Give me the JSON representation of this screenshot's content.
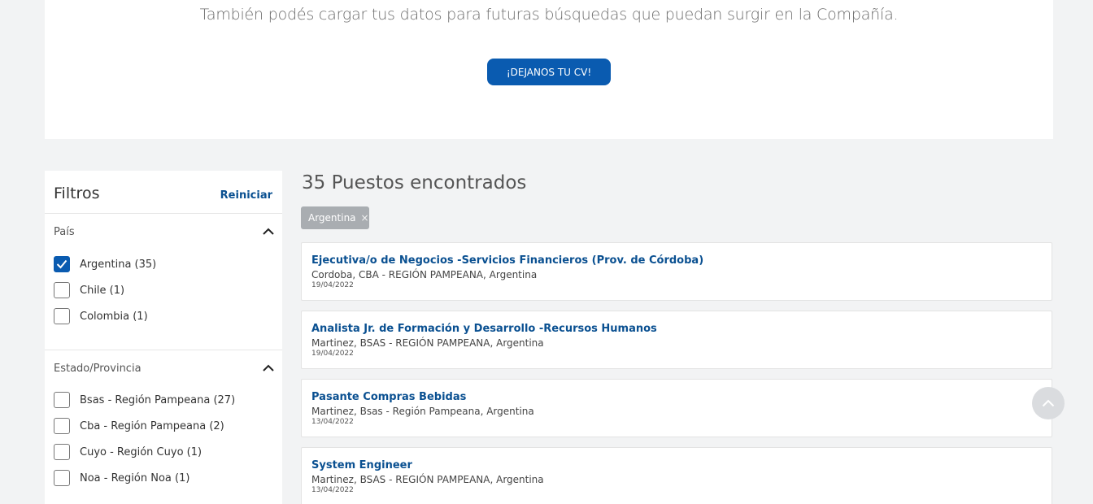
{
  "top": {
    "message": "También podés cargar tus datos para futuras búsquedas que puedan surgir en la Compañía.",
    "cv_button": "¡DEJANOS TU CV!"
  },
  "filters": {
    "title": "Filtros",
    "reset": "Reiniciar",
    "country": {
      "title": "País",
      "options": [
        {
          "label": "Argentina (35)",
          "checked": true
        },
        {
          "label": "Chile (1)",
          "checked": false
        },
        {
          "label": "Colombia (1)",
          "checked": false
        }
      ]
    },
    "state": {
      "title": "Estado/Provincia",
      "options": [
        {
          "label": "Bsas - Región Pampeana (27)",
          "checked": false
        },
        {
          "label": "Cba - Región Pampeana (2)",
          "checked": false
        },
        {
          "label": "Cuyo - Región Cuyo (1)",
          "checked": false
        },
        {
          "label": "Noa - Región Noa (1)",
          "checked": false
        }
      ]
    }
  },
  "results": {
    "title": "35 Puestos encontrados",
    "chip": "Argentina",
    "chip_close": "×",
    "jobs": [
      {
        "title": "Ejecutiva/o de Negocios -Servicios Financieros (Prov. de Córdoba)",
        "location": "Cordoba, CBA - REGIÓN PAMPEANA, Argentina",
        "date": "19/04/2022"
      },
      {
        "title": "Analista Jr. de Formación y Desarrollo -Recursos Humanos",
        "location": "Martinez, BSAS - REGIÓN PAMPEANA, Argentina",
        "date": "19/04/2022"
      },
      {
        "title": "Pasante Compras Bebidas",
        "location": "Martinez, Bsas - Región Pampeana, Argentina",
        "date": "13/04/2022"
      },
      {
        "title": "System Engineer",
        "location": "Martinez, BSAS - REGIÓN PAMPEANA, Argentina",
        "date": "13/04/2022"
      }
    ]
  },
  "icons": {
    "chevron_up": "chevron-up-icon",
    "check": "check-icon",
    "scroll_top": "chevron-up-icon"
  },
  "colors": {
    "accent": "#0a5bb0",
    "link": "#0a5091",
    "chip": "#a9adb1",
    "background": "#f2f3f4"
  }
}
